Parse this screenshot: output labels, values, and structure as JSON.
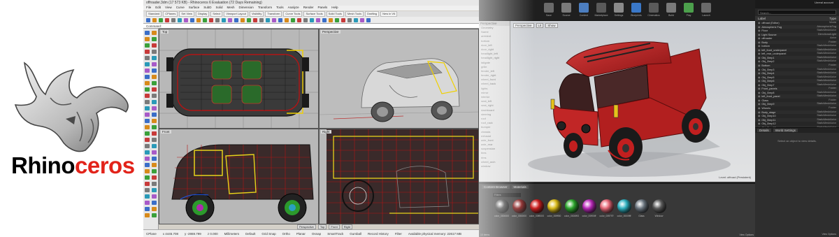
{
  "logo": {
    "text_part1": "Rhino",
    "text_part2": "ceros",
    "accent_color": "#e2231a"
  },
  "rhino": {
    "window_title": "offroader.3dm (17 573 KB) - Rhinoceros 6 Evaluation (72 Days Remaining)",
    "menu": [
      "File",
      "Edit",
      "View",
      "Curve",
      "Surface",
      "SubD",
      "Solid",
      "Mesh",
      "Dimension",
      "Transform",
      "Tools",
      "Analyze",
      "Render",
      "Panels",
      "Help"
    ],
    "toolbar_tabs": [
      "Standard",
      "CPlanes",
      "Set View",
      "Display",
      "Select",
      "Viewport Layout",
      "Visibility",
      "Transform",
      "Curve Tools",
      "Surface Tools",
      "Solid Tools",
      "Mesh Tools",
      "Drafting",
      "New in V6"
    ],
    "command_line": "Command:",
    "viewports": {
      "top": "Top",
      "perspective": "Perspective",
      "front": "Front",
      "right": "Right"
    },
    "viewport_tabs": [
      "Perspective",
      "Top",
      "Front",
      "Right"
    ],
    "status": [
      "CPlane",
      "x 4445.708",
      "y -2869.799",
      "z 0.000",
      "Millimeters",
      "Default",
      "Grid Snap",
      "Ortho",
      "Planar",
      "Osnap",
      "SmartTrack",
      "Gumball",
      "Record History",
      "Filter",
      "Available physical memory: 22617 MB"
    ]
  },
  "unreal": {
    "toolbar": [
      "Save",
      "Source",
      "Content",
      "Marketplace",
      "Settings",
      "Blueprints",
      "Cinematics",
      "Build",
      "Play",
      "Launch"
    ],
    "world_panel_title": "Perspective",
    "world_rows": [
      "Geometry",
      "Name",
      "ambient",
      "bottom",
      "door_left",
      "door_right",
      "headlight_left",
      "headlight_right",
      "tailgate",
      "grille",
      "fender_left",
      "fender_right",
      "wheel_front",
      "wheel_back",
      "lights",
      "mirror",
      "interior",
      "seat_left",
      "seat_right",
      "dashboard",
      "steering",
      "roof",
      "roof_rack",
      "bumper",
      "chassis",
      "exhaust",
      "axle_front",
      "axle_rear",
      "suspension",
      "tires",
      "rims",
      "wheel_arch",
      "window"
    ],
    "viewport_buttons": [
      "Perspective",
      "Lit",
      "Show"
    ],
    "viewport_corner": "Level: offroad (Persistent)",
    "content_tabs": [
      "Content Browser",
      "Materials"
    ],
    "content_filter": "Filters",
    "materials": [
      {
        "label": "color_0000000",
        "color": "#4a4a4a"
      },
      {
        "label": "color_0000000",
        "color": "#8a1a1a"
      },
      {
        "label": "color_00ff0000",
        "color": "#d41f1f"
      },
      {
        "label": "color_00ffff00",
        "color": "#e2c21a"
      },
      {
        "label": "color_0000ff00",
        "color": "#2fae2f"
      },
      {
        "label": "color_00ff00ff",
        "color": "#c02ac0"
      },
      {
        "label": "color_00ff7f7f",
        "color": "#ee6a7a"
      },
      {
        "label": "color_0000ffff",
        "color": "#2fb8c8"
      },
      {
        "label": "Glass",
        "color": "#707b85"
      },
      {
        "label": "Window",
        "color": "#5f5f5f"
      }
    ],
    "content_footer": "10 items",
    "content_view_options": "View Options"
  },
  "outliner": {
    "account_badge": "Unreal account",
    "search_placeholder": "Search...",
    "header_label": "Label",
    "header_type": "Type",
    "rows": [
      {
        "label": "offroad (Editor)",
        "type": "World"
      },
      {
        "label": "Atmospheric Fog",
        "type": "AtmosphericFog"
      },
      {
        "label": "Floor",
        "type": "StaticMeshActor"
      },
      {
        "label": "Light Source",
        "type": "DirectionalLight"
      },
      {
        "label": "offroader",
        "type": "Actor"
      },
      {
        "label": "Body",
        "type": "Folder"
      },
      {
        "label": "bottom",
        "type": "StaticMeshActor"
      },
      {
        "label": "left_front_underpanel",
        "type": "StaticMeshActor"
      },
      {
        "label": "left_rear_underpanel",
        "type": "StaticMeshActor"
      },
      {
        "label": "Obj_Brep1",
        "type": "StaticMeshActor"
      },
      {
        "label": "Obj_Brep2",
        "type": "StaticMeshActor"
      },
      {
        "label": "Bottom",
        "type": "Folder"
      },
      {
        "label": "Obj_Brep3",
        "type": "StaticMeshActor"
      },
      {
        "label": "Obj_Brep4",
        "type": "StaticMeshActor"
      },
      {
        "label": "Obj_Brep5",
        "type": "StaticMeshActor"
      },
      {
        "label": "Obj_Brep6",
        "type": "StaticMeshActor"
      },
      {
        "label": "Obj_Brep7",
        "type": "StaticMeshActor"
      },
      {
        "label": "Front_panels",
        "type": "Folder"
      },
      {
        "label": "Obj_Brep8",
        "type": "StaticMeshActor"
      },
      {
        "label": "left_front_panel",
        "type": "StaticMeshActor"
      },
      {
        "label": "Glass",
        "type": "Folder"
      },
      {
        "label": "Obj_Brep9",
        "type": "StaticMeshActor"
      },
      {
        "label": "Wheels",
        "type": "Folder"
      },
      {
        "label": "Body_stage",
        "type": "StaticMeshActor"
      },
      {
        "label": "Obj_Brep10",
        "type": "StaticMeshActor"
      },
      {
        "label": "Obj_Brep11",
        "type": "StaticMeshActor"
      },
      {
        "label": "Obj_Brep12",
        "type": "StaticMeshActor"
      },
      {
        "label": "Obj_Brep13",
        "type": "StaticMeshActor"
      },
      {
        "label": "Obj_Brep14",
        "type": "StaticMeshActor"
      },
      {
        "label": "Obj_Brep15",
        "type": "StaticMeshActor"
      },
      {
        "label": "Obj_Brep16",
        "type": "StaticMeshActor"
      }
    ],
    "actor_count": "299 actors",
    "view_options": "View Options",
    "details_tabs": [
      "Details",
      "World Settings"
    ],
    "details_hint": "Select an object to view details.",
    "details_footer": "View Options"
  }
}
